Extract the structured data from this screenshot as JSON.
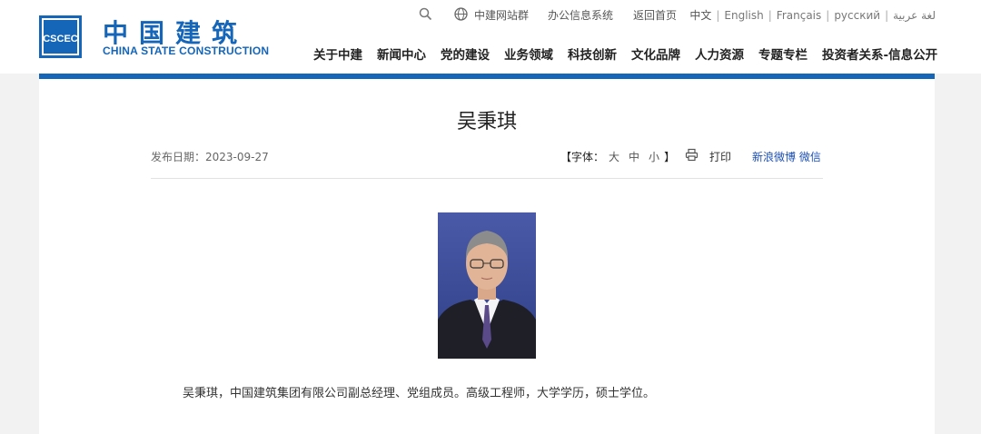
{
  "logo": {
    "mark_text": "CSCEC",
    "name_cn": "中国建筑",
    "name_en": "CHINA STATE CONSTRUCTION"
  },
  "utility": {
    "site_group": "中建网站群",
    "oa_system": "办公信息系统",
    "home": "返回首页"
  },
  "languages": [
    "中文",
    "English",
    "Français",
    "русский",
    "لغة عربية"
  ],
  "nav": [
    "关于中建",
    "新闻中心",
    "党的建设",
    "业务领域",
    "科技创新",
    "文化品牌",
    "人力资源",
    "专题专栏",
    "投资者关系-信息公开"
  ],
  "article": {
    "title": "吴秉琪",
    "date_label": "发布日期：",
    "date": "2023-09-27",
    "fontsize_open": "【字体：",
    "fontsize_large": "大",
    "fontsize_medium": "中",
    "fontsize_small": "小",
    "fontsize_close": "】",
    "print": "打印",
    "share_weibo": "新浪微博",
    "share_wechat": "微信",
    "bio": "吴秉琪，中国建筑集团有限公司副总经理、党组成员。高级工程师，大学学历，硕士学位。"
  },
  "colors": {
    "brand_blue": "#1565b8",
    "share_link": "#1a4fb6",
    "page_bg": "#f2f2f2"
  },
  "icons": [
    "search-icon",
    "globe-icon",
    "print-icon"
  ]
}
